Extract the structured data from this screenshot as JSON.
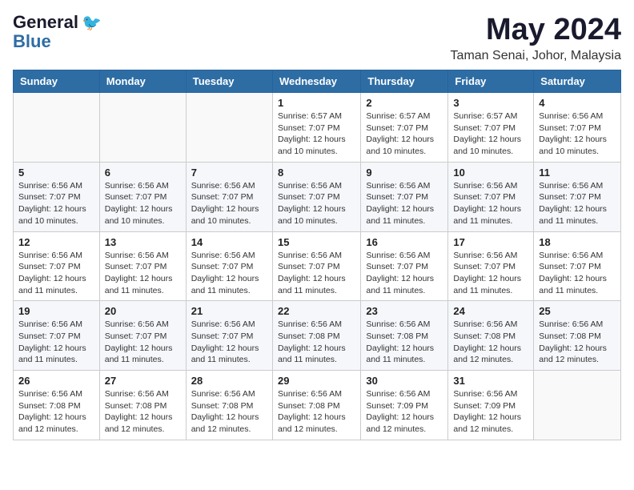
{
  "logo": {
    "general": "General",
    "blue": "Blue"
  },
  "title": "May 2024",
  "location": "Taman Senai, Johor, Malaysia",
  "days_of_week": [
    "Sunday",
    "Monday",
    "Tuesday",
    "Wednesday",
    "Thursday",
    "Friday",
    "Saturday"
  ],
  "weeks": [
    [
      {
        "day": "",
        "info": ""
      },
      {
        "day": "",
        "info": ""
      },
      {
        "day": "",
        "info": ""
      },
      {
        "day": "1",
        "info": "Sunrise: 6:57 AM\nSunset: 7:07 PM\nDaylight: 12 hours and 10 minutes."
      },
      {
        "day": "2",
        "info": "Sunrise: 6:57 AM\nSunset: 7:07 PM\nDaylight: 12 hours and 10 minutes."
      },
      {
        "day": "3",
        "info": "Sunrise: 6:57 AM\nSunset: 7:07 PM\nDaylight: 12 hours and 10 minutes."
      },
      {
        "day": "4",
        "info": "Sunrise: 6:56 AM\nSunset: 7:07 PM\nDaylight: 12 hours and 10 minutes."
      }
    ],
    [
      {
        "day": "5",
        "info": "Sunrise: 6:56 AM\nSunset: 7:07 PM\nDaylight: 12 hours and 10 minutes."
      },
      {
        "day": "6",
        "info": "Sunrise: 6:56 AM\nSunset: 7:07 PM\nDaylight: 12 hours and 10 minutes."
      },
      {
        "day": "7",
        "info": "Sunrise: 6:56 AM\nSunset: 7:07 PM\nDaylight: 12 hours and 10 minutes."
      },
      {
        "day": "8",
        "info": "Sunrise: 6:56 AM\nSunset: 7:07 PM\nDaylight: 12 hours and 10 minutes."
      },
      {
        "day": "9",
        "info": "Sunrise: 6:56 AM\nSunset: 7:07 PM\nDaylight: 12 hours and 11 minutes."
      },
      {
        "day": "10",
        "info": "Sunrise: 6:56 AM\nSunset: 7:07 PM\nDaylight: 12 hours and 11 minutes."
      },
      {
        "day": "11",
        "info": "Sunrise: 6:56 AM\nSunset: 7:07 PM\nDaylight: 12 hours and 11 minutes."
      }
    ],
    [
      {
        "day": "12",
        "info": "Sunrise: 6:56 AM\nSunset: 7:07 PM\nDaylight: 12 hours and 11 minutes."
      },
      {
        "day": "13",
        "info": "Sunrise: 6:56 AM\nSunset: 7:07 PM\nDaylight: 12 hours and 11 minutes."
      },
      {
        "day": "14",
        "info": "Sunrise: 6:56 AM\nSunset: 7:07 PM\nDaylight: 12 hours and 11 minutes."
      },
      {
        "day": "15",
        "info": "Sunrise: 6:56 AM\nSunset: 7:07 PM\nDaylight: 12 hours and 11 minutes."
      },
      {
        "day": "16",
        "info": "Sunrise: 6:56 AM\nSunset: 7:07 PM\nDaylight: 12 hours and 11 minutes."
      },
      {
        "day": "17",
        "info": "Sunrise: 6:56 AM\nSunset: 7:07 PM\nDaylight: 12 hours and 11 minutes."
      },
      {
        "day": "18",
        "info": "Sunrise: 6:56 AM\nSunset: 7:07 PM\nDaylight: 12 hours and 11 minutes."
      }
    ],
    [
      {
        "day": "19",
        "info": "Sunrise: 6:56 AM\nSunset: 7:07 PM\nDaylight: 12 hours and 11 minutes."
      },
      {
        "day": "20",
        "info": "Sunrise: 6:56 AM\nSunset: 7:07 PM\nDaylight: 12 hours and 11 minutes."
      },
      {
        "day": "21",
        "info": "Sunrise: 6:56 AM\nSunset: 7:07 PM\nDaylight: 12 hours and 11 minutes."
      },
      {
        "day": "22",
        "info": "Sunrise: 6:56 AM\nSunset: 7:08 PM\nDaylight: 12 hours and 11 minutes."
      },
      {
        "day": "23",
        "info": "Sunrise: 6:56 AM\nSunset: 7:08 PM\nDaylight: 12 hours and 11 minutes."
      },
      {
        "day": "24",
        "info": "Sunrise: 6:56 AM\nSunset: 7:08 PM\nDaylight: 12 hours and 12 minutes."
      },
      {
        "day": "25",
        "info": "Sunrise: 6:56 AM\nSunset: 7:08 PM\nDaylight: 12 hours and 12 minutes."
      }
    ],
    [
      {
        "day": "26",
        "info": "Sunrise: 6:56 AM\nSunset: 7:08 PM\nDaylight: 12 hours and 12 minutes."
      },
      {
        "day": "27",
        "info": "Sunrise: 6:56 AM\nSunset: 7:08 PM\nDaylight: 12 hours and 12 minutes."
      },
      {
        "day": "28",
        "info": "Sunrise: 6:56 AM\nSunset: 7:08 PM\nDaylight: 12 hours and 12 minutes."
      },
      {
        "day": "29",
        "info": "Sunrise: 6:56 AM\nSunset: 7:08 PM\nDaylight: 12 hours and 12 minutes."
      },
      {
        "day": "30",
        "info": "Sunrise: 6:56 AM\nSunset: 7:09 PM\nDaylight: 12 hours and 12 minutes."
      },
      {
        "day": "31",
        "info": "Sunrise: 6:56 AM\nSunset: 7:09 PM\nDaylight: 12 hours and 12 minutes."
      },
      {
        "day": "",
        "info": ""
      }
    ]
  ]
}
